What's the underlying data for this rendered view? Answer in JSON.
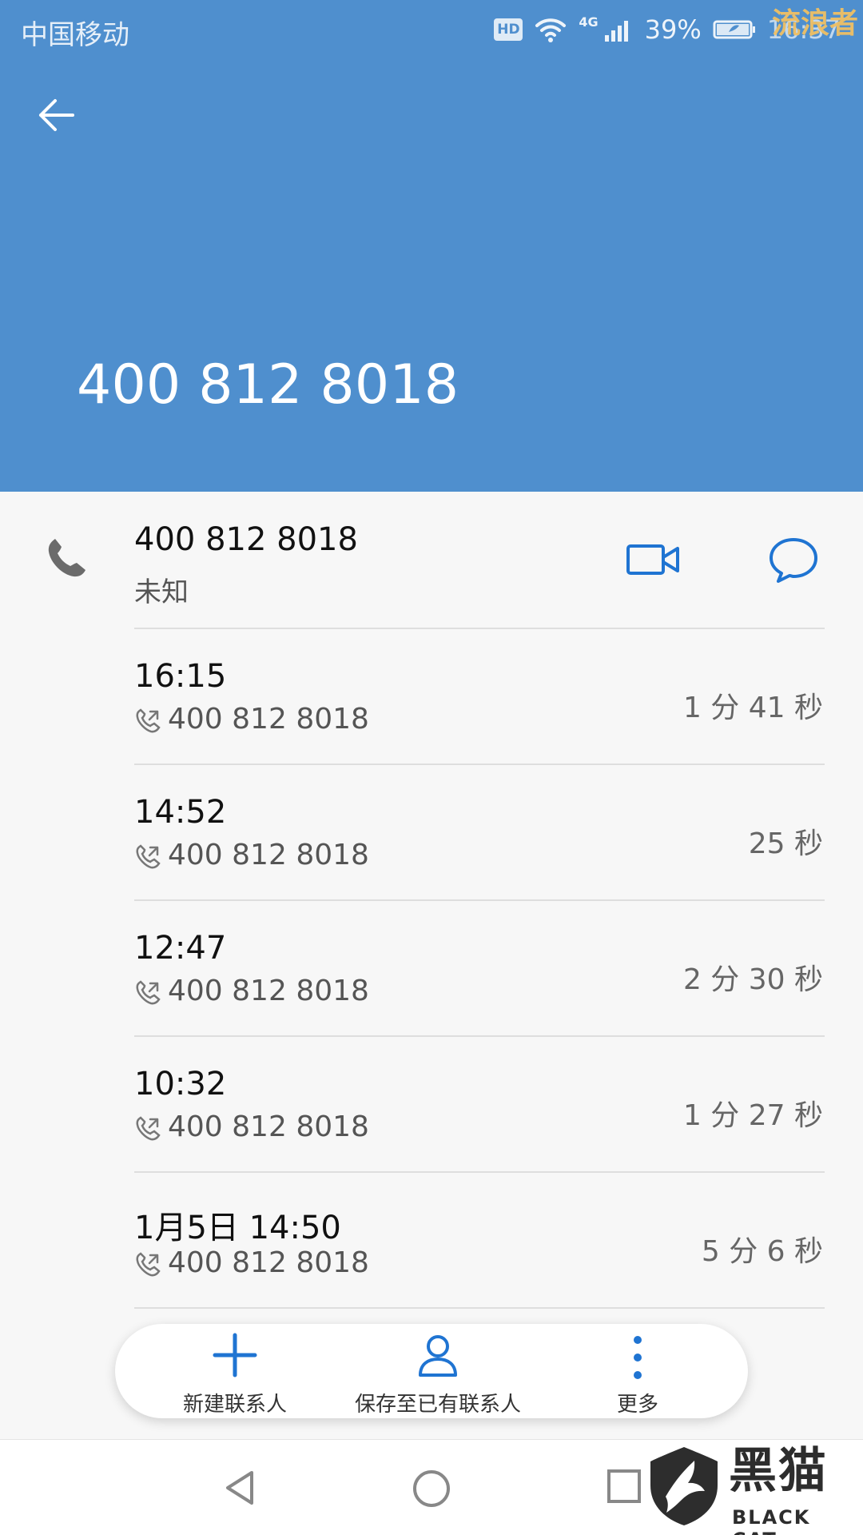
{
  "status_bar": {
    "carrier": "中国移动",
    "hd": "HD",
    "network": "4G",
    "battery_percent": "39%",
    "clock": "16:37",
    "icons": [
      "hd-icon",
      "wifi-icon",
      "signal-icon",
      "battery-icon"
    ]
  },
  "header": {
    "number": "400 812 8018"
  },
  "contact": {
    "number": "400 812 8018",
    "label": "未知"
  },
  "calls": [
    {
      "time": "16:15",
      "number": "400 812 8018",
      "duration": "1 分 41 秒"
    },
    {
      "time": "14:52",
      "number": "400 812 8018",
      "duration": "25 秒"
    },
    {
      "time": "12:47",
      "number": "400 812 8018",
      "duration": "2 分 30 秒"
    },
    {
      "time": "10:32",
      "number": "400 812 8018",
      "duration": "1 分 27 秒"
    },
    {
      "time": "1月5日 14:50",
      "number": "400 812 8018",
      "duration": "5 分 6 秒"
    }
  ],
  "actions": {
    "add_contact": "新建联系人",
    "save_existing": "保存至已有联系人",
    "more": "更多"
  },
  "watermark": {
    "corner": "流浪者",
    "brand": "黑猫",
    "brand_sub": "BLACK CAT"
  },
  "colors": {
    "header": "#4f8fce",
    "accent": "#1f74d2",
    "background": "#f7f7f7"
  }
}
